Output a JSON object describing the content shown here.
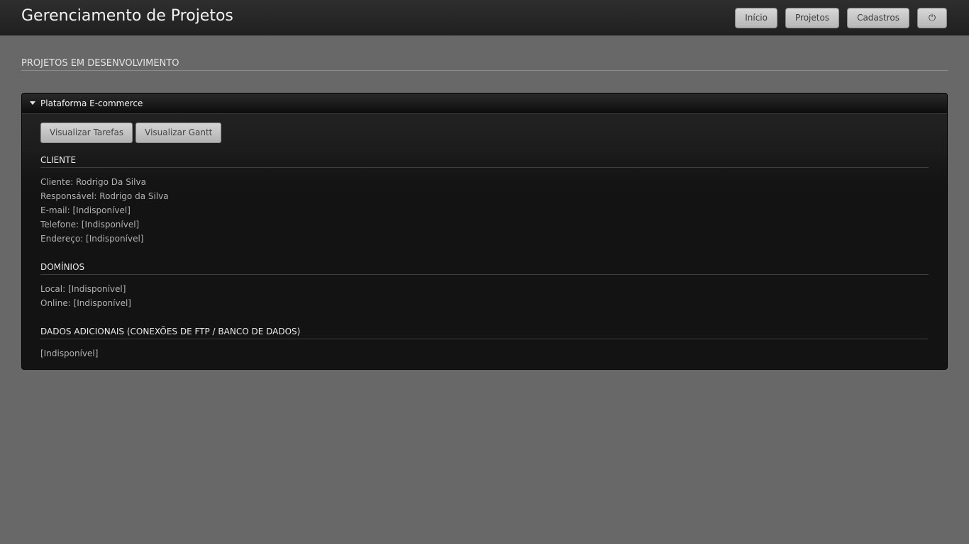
{
  "header": {
    "title": "Gerenciamento de Projetos",
    "nav": [
      {
        "label": "Início"
      },
      {
        "label": "Projetos"
      },
      {
        "label": "Cadastros"
      }
    ],
    "power_icon": "power-icon",
    "power_glyph": "⏻"
  },
  "section": {
    "title": "PROJETOS EM DESENVOLVIMENTO"
  },
  "project": {
    "name": "Plataforma E-commerce",
    "expanded": true,
    "actions": {
      "tasks_label": "Visualizar Tarefas",
      "gantt_label": "Visualizar Gantt"
    },
    "client": {
      "title": "CLIENTE",
      "fields": [
        "Cliente: Rodrigo Da Silva",
        "Responsável: Rodrigo da Silva",
        "E-mail: [Indisponível]",
        "Telefone: [Indisponível]",
        "Endereço: [Indisponível]"
      ]
    },
    "domains": {
      "title": "DOMÍNIOS",
      "fields": [
        "Local: [Indisponível]",
        "Online: [Indisponível]"
      ]
    },
    "extra": {
      "title": "DADOS ADICIONAIS (CONEXÕES DE FTP / BANCO DE DADOS)",
      "fields": [
        "[Indisponível]"
      ]
    }
  },
  "colors": {
    "background": "#686868",
    "topbar": "#252525",
    "panel": "#131313",
    "button": "#c4c4c4"
  }
}
